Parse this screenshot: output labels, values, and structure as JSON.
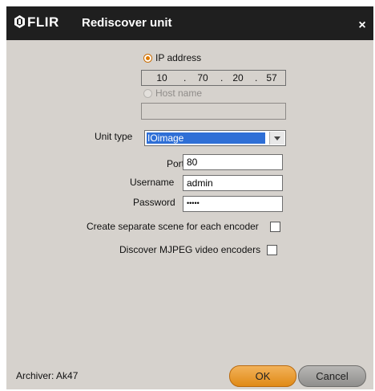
{
  "window": {
    "logo_text": "FLIR",
    "title": "Rediscover unit",
    "close_glyph": "×"
  },
  "address": {
    "ip_option_label": "IP address",
    "ip_selected": true,
    "ip_octets": [
      "10",
      "70",
      "20",
      "57"
    ],
    "ip_separator": ".",
    "hostname_option_label": "Host name",
    "hostname_value": ""
  },
  "unit_type": {
    "label": "Unit type",
    "selected_value": "IOimage"
  },
  "connection": {
    "port_label": "Port",
    "port_value": "80",
    "username_label": "Username",
    "username_value": "admin",
    "password_label": "Password",
    "password_value": "•••••"
  },
  "options": {
    "separate_scene_label": "Create separate scene for each encoder",
    "separate_scene_checked": false,
    "discover_mjpeg_label": "Discover MJPEG video encoders",
    "discover_mjpeg_checked": false
  },
  "footer": {
    "archiver_label": "Archiver: Ak47",
    "ok_label": "OK",
    "cancel_label": "Cancel"
  },
  "colors": {
    "accent": "#e07b00",
    "titlebar": "#1f1f1f",
    "dialog_bg": "#d6d2cd",
    "selection": "#2f6fd6"
  }
}
